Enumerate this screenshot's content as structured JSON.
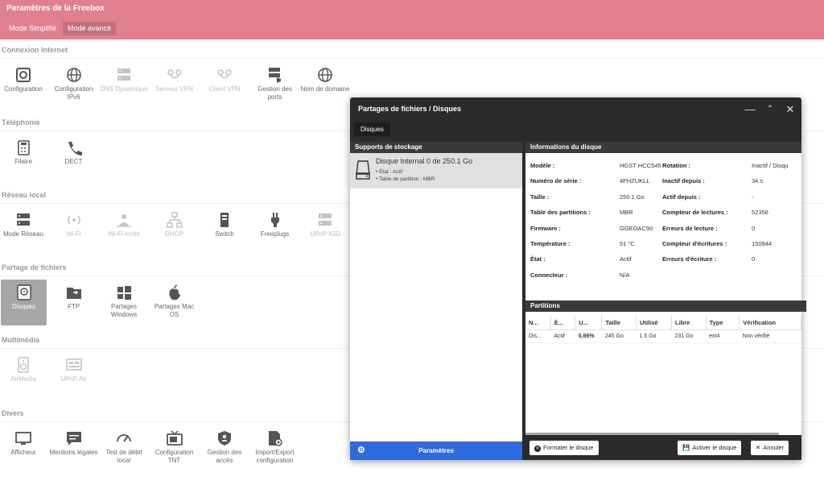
{
  "app": {
    "title": "Paramètres de la Freebox",
    "modes": [
      "Mode Simplifié",
      "Mode avancé"
    ]
  },
  "sections": [
    {
      "title": "Connexion Internet",
      "apps": [
        {
          "label": "Configuration",
          "icon": "gear-icon"
        },
        {
          "label": "Configuration IPv6",
          "icon": "globe-icon"
        },
        {
          "label": "DNS Dynamique",
          "icon": "server-icon"
        },
        {
          "label": "Serveur VPN",
          "icon": "vpn-icon"
        },
        {
          "label": "Client VPN",
          "icon": "vpn-icon"
        },
        {
          "label": "Gestion des ports",
          "icon": "ports-icon"
        },
        {
          "label": "Nom de domaine",
          "icon": "globe-icon"
        }
      ]
    },
    {
      "title": "Téléphonie",
      "apps": [
        {
          "label": "Filaire",
          "icon": "phone-desk-icon"
        },
        {
          "label": "DECT",
          "icon": "phone-icon"
        }
      ]
    },
    {
      "title": "Réseau local",
      "apps": [
        {
          "label": "Mode Réseau",
          "icon": "server-icon"
        },
        {
          "label": "Wi-Fi",
          "icon": "wifi-icon"
        },
        {
          "label": "Wi-Fi invité",
          "icon": "guest-wifi-icon"
        },
        {
          "label": "DHCP",
          "icon": "network-icon"
        },
        {
          "label": "Switch",
          "icon": "switch-icon"
        },
        {
          "label": "Freeplugs",
          "icon": "plug-icon"
        },
        {
          "label": "UPnP IGD",
          "icon": "server-icon"
        }
      ]
    },
    {
      "title": "Partage de fichiers",
      "apps": [
        {
          "label": "Disques",
          "icon": "disk-icon"
        },
        {
          "label": "FTP",
          "icon": "folder-icon"
        },
        {
          "label": "Partages Windows",
          "icon": "windows-icon"
        },
        {
          "label": "Partages Mac OS",
          "icon": "apple-icon"
        }
      ]
    },
    {
      "title": "Multimédia",
      "apps": [
        {
          "label": "AirMedia",
          "icon": "speaker-icon"
        },
        {
          "label": "UPnP AV",
          "icon": "media-icon"
        }
      ]
    },
    {
      "title": "Divers",
      "apps": [
        {
          "label": "Afficheur",
          "icon": "monitor-icon"
        },
        {
          "label": "Mentions légales",
          "icon": "message-icon"
        },
        {
          "label": "Test de débit local",
          "icon": "gauge-icon"
        },
        {
          "label": "Configuration TNT",
          "icon": "tv-icon"
        },
        {
          "label": "Gestion des accès",
          "icon": "shield-icon"
        },
        {
          "label": "Import/Export configuration",
          "icon": "import-export-icon"
        }
      ]
    }
  ],
  "modal": {
    "title": "Partages de fichiers / Disques",
    "tab": "Disques",
    "storage": {
      "heading": "Supports de stockage",
      "disk_name": "Disque Internal 0 de 250.1 Go",
      "disk_state": "• État : Actif",
      "disk_table": "• Table de partition : MBR",
      "params_button": "Paramètres"
    },
    "info": {
      "heading": "Informations du disque",
      "left": [
        {
          "k": "Modèle :",
          "v": "HGST HCC545"
        },
        {
          "k": "Numéro de série :",
          "v": "4FHZUKLL"
        },
        {
          "k": "Taille :",
          "v": "250.1 Go"
        },
        {
          "k": "Table des partitions :",
          "v": "MBR"
        },
        {
          "k": "Firmware :",
          "v": "GGEOAC90"
        },
        {
          "k": "Température :",
          "v": "51 °C"
        },
        {
          "k": "État :",
          "v": "Actif"
        },
        {
          "k": "Connecteur :",
          "v": "N/A"
        }
      ],
      "right": [
        {
          "k": "Rotation :",
          "v": "Inactif / Disqu"
        },
        {
          "k": "Inactif depuis :",
          "v": "34 s"
        },
        {
          "k": "Actif depuis :",
          "v": "-"
        },
        {
          "k": "Compteur de lectures :",
          "v": "52356"
        },
        {
          "k": "Erreurs de lecture :",
          "v": "0"
        },
        {
          "k": "Compteur d'écritures :",
          "v": "150944"
        },
        {
          "k": "Erreurs d'écriture :",
          "v": "0"
        }
      ]
    },
    "partitions": {
      "heading": "Partitions",
      "columns": [
        "N...",
        "É...",
        "U...",
        "Taille",
        "Utilisé",
        "Libre",
        "Type",
        "Vérification"
      ],
      "rows": [
        [
          "Dis...",
          "Actif",
          "0,66%",
          "245 Go",
          "1.5 Go",
          "231 Go",
          "ext4",
          "Non vérifié"
        ]
      ]
    },
    "buttons": {
      "format": "Formater le disque",
      "activate": "Activer le disque",
      "cancel": "Annuler"
    }
  }
}
